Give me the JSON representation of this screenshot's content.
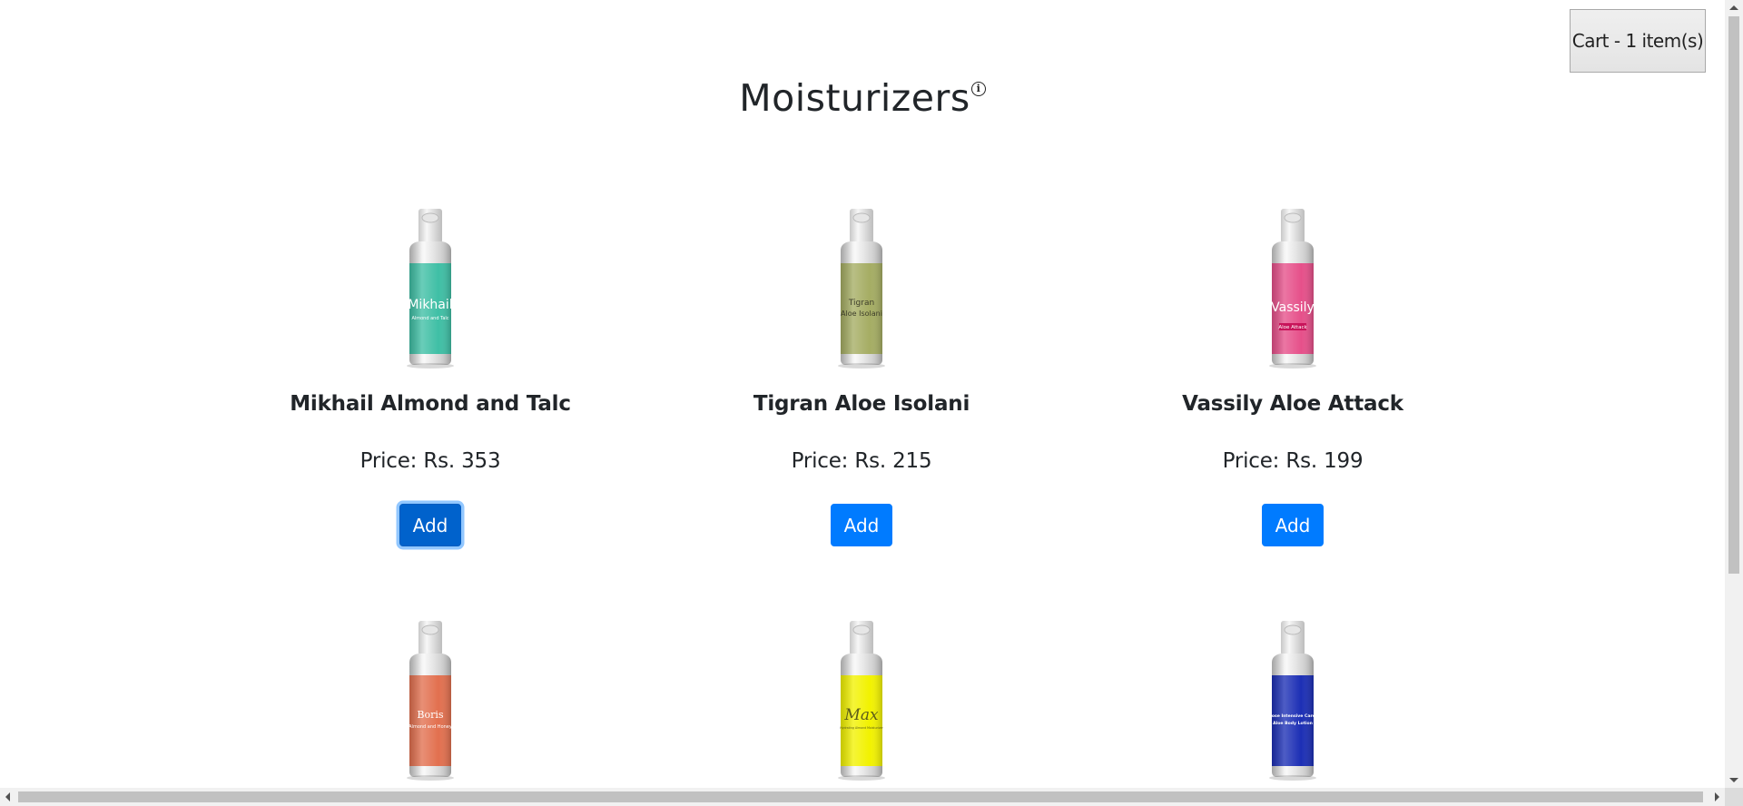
{
  "cart": {
    "label": "Cart - 1 item(s)"
  },
  "page": {
    "title": "Moisturizers",
    "info_icon": "info-circle-icon"
  },
  "add_label": "Add",
  "products": [
    {
      "name": "Mikhail Almond and Talc",
      "price": "Price: Rs. 353",
      "bottle_color": "#3fbfa5",
      "brand": "Mikhail",
      "subtitle": "Almond and Talc",
      "brand_color": "#ffffff"
    },
    {
      "name": "Tigran Aloe Isolani",
      "price": "Price: Rs. 215",
      "bottle_color": "#a5ad63",
      "brand": "Tigran",
      "subtitle": "Aloe Isolani",
      "brand_color": "#3d3d2a"
    },
    {
      "name": "Vassily Aloe Attack",
      "price": "Price: Rs. 199",
      "bottle_color": "#e6508a",
      "brand": "Vassily",
      "subtitle": "Aloe Attack",
      "brand_color": "#ffffff"
    },
    {
      "name": "",
      "price": "",
      "bottle_color": "#e2704f",
      "brand": "Boris",
      "subtitle": "Almond and Honey",
      "brand_color": "#ffffff"
    },
    {
      "name": "",
      "price": "",
      "bottle_color": "#f2f200",
      "brand": "Max",
      "subtitle": "Hydrating Almond Moisturizer",
      "brand_color": "#5c5c1a"
    },
    {
      "name": "",
      "price": "",
      "bottle_color": "#1c2fb5",
      "brand": "Jose Intensive Care",
      "subtitle": "Aloe Body Lotion",
      "brand_color": "#ffffff"
    }
  ],
  "colors": {
    "primary": "#007bff",
    "primary_focus": "#0062cc"
  }
}
